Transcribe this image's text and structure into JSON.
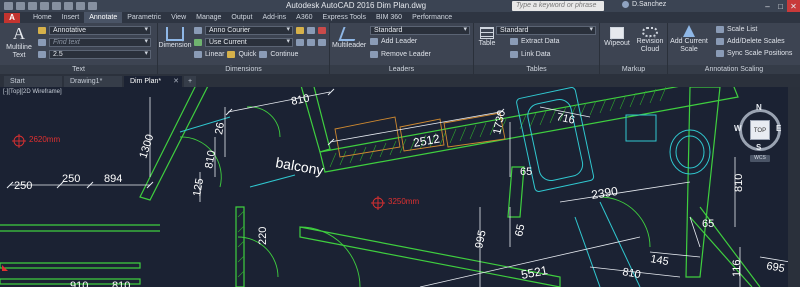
{
  "titlebar": {
    "title": "Autodesk AutoCAD 2016    Dim Plan.dwg",
    "search_placeholder": "Type a keyword or phrase",
    "user": "D.Sanchez"
  },
  "menu_tabs": [
    "Home",
    "Insert",
    "Annotate",
    "Parametric",
    "View",
    "Manage",
    "Output",
    "Add-ins",
    "A360",
    "Express Tools",
    "BIM 360",
    "Performance"
  ],
  "active_tab": "Annotate",
  "ribbon": {
    "text_panel": {
      "title": "Text",
      "multiline_label": "Multiline Text",
      "style": "Annotative",
      "find_placeholder": "Find text",
      "height": "2.5"
    },
    "dimensions_panel": {
      "title": "Dimensions",
      "dimension_label": "Dimension",
      "style": "Anno Courier",
      "layer": "Use Current",
      "linear": "Linear",
      "quick": "Quick",
      "continue": "Continue"
    },
    "leaders_panel": {
      "title": "Leaders",
      "multileader_label": "Multileader",
      "style": "Standard",
      "add_leader": "Add Leader",
      "remove_leader": "Remove Leader"
    },
    "tables_panel": {
      "title": "Tables",
      "table_label": "Table",
      "style": "Standard",
      "extract_data": "Extract Data",
      "link_data": "Link Data"
    },
    "markup_panel": {
      "title": "Markup",
      "wipeout_label": "Wipeout",
      "revision_cloud_label": "Revision Cloud"
    },
    "annotation_scaling_panel": {
      "title": "Annotation Scaling",
      "add_current_scale_label": "Add Current Scale",
      "scale_list": "Scale List",
      "add_delete_scales": "Add/Delete Scales",
      "sync_scale_positions": "Sync Scale Positions"
    }
  },
  "doc_tabs": [
    "Start",
    "Drawing1*",
    "Dim Plan*"
  ],
  "active_doc_tab": "Dim Plan*",
  "viewport_control": "[-][Top][2D Wireframe]",
  "drawing": {
    "dimensions": [
      "810",
      "2512",
      "1730",
      "716",
      "26",
      "1300",
      "810",
      "65",
      "250",
      "250",
      "894",
      "2390",
      "125",
      "810",
      "220",
      "995",
      "65",
      "5521",
      "810",
      "145",
      "116",
      "65",
      "695",
      "910",
      "810"
    ],
    "room_label": "balcony",
    "level_marks": [
      "2620mm",
      "3250mm"
    ]
  },
  "viewcube": {
    "top": "TOP",
    "n": "N",
    "s": "S",
    "e": "E",
    "w": "W",
    "wcs": "WCS"
  },
  "colors": {
    "app_red": "#c3342f",
    "dim_white": "#ffffff",
    "wall_green": "#3fcf3f",
    "cyan": "#30c8d0",
    "orange": "#d08a30",
    "level_red": "#e03030"
  }
}
